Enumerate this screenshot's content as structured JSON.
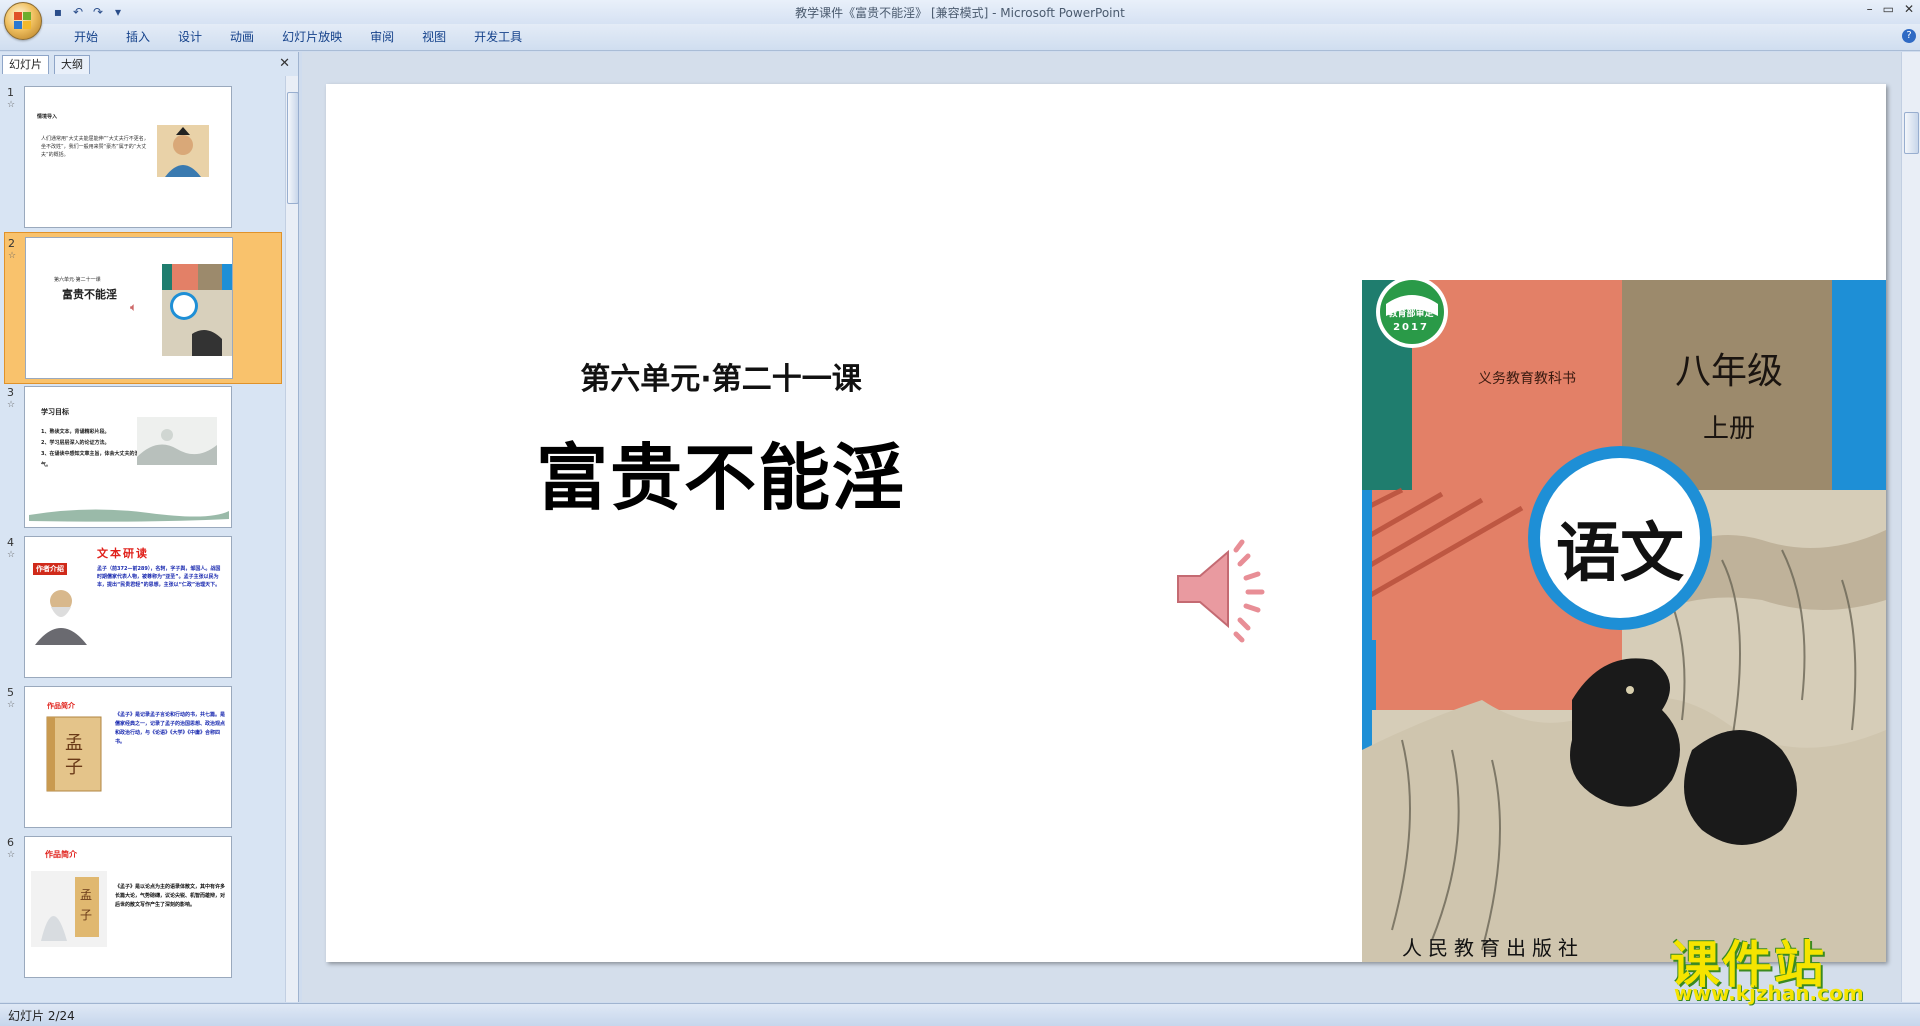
{
  "window": {
    "title": "教学课件《富贵不能淫》 [兼容模式] - Microsoft PowerPoint",
    "controls": [
      "–",
      "▭",
      "✕"
    ]
  },
  "quick_access": {
    "icons": [
      "save-icon",
      "undo-icon",
      "redo-icon",
      "customize-icon"
    ]
  },
  "ribbon_tabs": [
    "开始",
    "插入",
    "设计",
    "动画",
    "幻灯片放映",
    "审阅",
    "视图",
    "开发工具"
  ],
  "left_pane": {
    "tabs": [
      "幻灯片",
      "大纲"
    ],
    "close": "✕",
    "slides": [
      {
        "num": "1",
        "title": "情境导入",
        "body": "人们通常用“大丈夫能屈能伸”“大丈夫行不更名，坐不改姓”，我们一般用来赞“豪杰”属于的“大丈夫”的概括。"
      },
      {
        "num": "2",
        "subtitle": "第六单元·第二十一课",
        "title": "富贵不能淫"
      },
      {
        "num": "3",
        "title": "学习目标",
        "items": [
          "1、熟读文本，背诵精彩片段。",
          "2、学习层层深入的论证方法。",
          "3、在诵读中感知文章主旨，体会大丈夫的浩然之气。"
        ]
      },
      {
        "num": "4",
        "title": "文本研读",
        "tag": "作者介绍",
        "body": "孟子（前372—前289），名轲，字子舆，邹国人。战国时期儒家代表人物，被尊称为“亚圣”。孟子主张以民为本，提出“民贵君轻”的思想，主张以“仁政”治理天下。"
      },
      {
        "num": "5",
        "title": "作品简介",
        "body": "《孟子》是记录孟子言论和行动的书，共七篇。是儒家经典之一，记录了孟子的治国思想、政治观点和政治行动，与《论语》《大学》《中庸》合称四书。"
      },
      {
        "num": "6",
        "title": "作品简介",
        "body": "《孟子》是以论点为主的语录体散文，其中有许多长篇大论，气势磅礴，议论尖锐、机智而雄辩，对后世的散文写作产生了深刻的影响。"
      }
    ]
  },
  "slide": {
    "subtitle": "第六单元·第二十一课",
    "title": "富贵不能淫",
    "book": {
      "badge_top": "教育部审定",
      "badge_year": "2017",
      "series": "义务教育教科书",
      "grade": "八年级",
      "volume": "上册",
      "subject": "语文",
      "publisher": "人民教育出版社"
    }
  },
  "status": {
    "slide_indicator": "幻灯片 2/24"
  },
  "watermark": {
    "name": "课件站",
    "url": "www.kjzhan.com"
  },
  "colors": {
    "accent": "#f9c26c",
    "ribbon_text": "#15428b",
    "book_teal": "#1f7d6e",
    "book_salmon": "#e38067",
    "book_blue": "#1e8fd6"
  }
}
